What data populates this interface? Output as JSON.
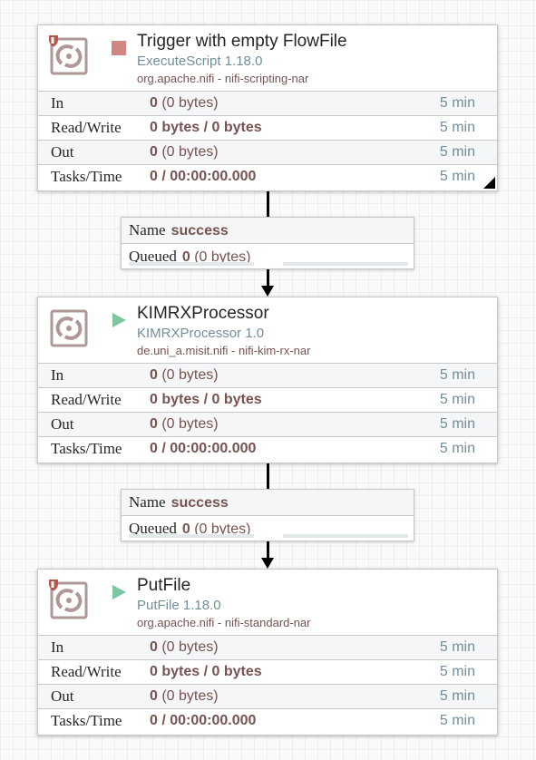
{
  "processors": [
    {
      "name": "Trigger with empty FlowFile",
      "type": "ExecuteScript 1.18.0",
      "bundle": "org.apache.nifi - nifi-scripting-nar",
      "status": "stopped",
      "restricted": true,
      "stats": {
        "in": {
          "label": "In",
          "count": "0",
          "size": " (0 bytes)",
          "time": "5 min"
        },
        "read_write": {
          "label": "Read/Write",
          "value": "0 bytes / 0 bytes",
          "time": "5 min"
        },
        "out": {
          "label": "Out",
          "count": "0",
          "size": " (0 bytes)",
          "time": "5 min"
        },
        "tasks": {
          "label": "Tasks/Time",
          "value": "0 / 00:00:00.000",
          "time": "5 min"
        }
      }
    },
    {
      "name": "KIMRXProcessor",
      "type": "KIMRXProcessor 1.0",
      "bundle": "de.uni_a.misit.nifi - nifi-kim-rx-nar",
      "status": "running",
      "restricted": false,
      "stats": {
        "in": {
          "label": "In",
          "count": "0",
          "size": " (0 bytes)",
          "time": "5 min"
        },
        "read_write": {
          "label": "Read/Write",
          "value": "0 bytes / 0 bytes",
          "time": "5 min"
        },
        "out": {
          "label": "Out",
          "count": "0",
          "size": " (0 bytes)",
          "time": "5 min"
        },
        "tasks": {
          "label": "Tasks/Time",
          "value": "0 / 00:00:00.000",
          "time": "5 min"
        }
      }
    },
    {
      "name": "PutFile",
      "type": "PutFile 1.18.0",
      "bundle": "org.apache.nifi - nifi-standard-nar",
      "status": "running",
      "restricted": true,
      "stats": {
        "in": {
          "label": "In",
          "count": "0",
          "size": " (0 bytes)",
          "time": "5 min"
        },
        "read_write": {
          "label": "Read/Write",
          "value": "0 bytes / 0 bytes",
          "time": "5 min"
        },
        "out": {
          "label": "Out",
          "count": "0",
          "size": " (0 bytes)",
          "time": "5 min"
        },
        "tasks": {
          "label": "Tasks/Time",
          "value": "0 / 00:00:00.000",
          "time": "5 min"
        }
      }
    }
  ],
  "connections": [
    {
      "name_label": "Name",
      "name": "success",
      "queued_label": "Queued",
      "queued_count": "0",
      "queued_size": " (0 bytes)"
    },
    {
      "name_label": "Name",
      "name": "success",
      "queued_label": "Queued",
      "queued_count": "0",
      "queued_size": " (0 bytes)"
    }
  ],
  "colors": {
    "processor_icon": "#ad9897",
    "stopped": "#d18686",
    "running": "#7dc7a0",
    "restricted": "#ba554a",
    "type_text": "#728e9b",
    "value_text": "#775351"
  },
  "icons": [
    "processor-icon",
    "restricted-shield-icon",
    "stopped-icon",
    "running-icon"
  ]
}
